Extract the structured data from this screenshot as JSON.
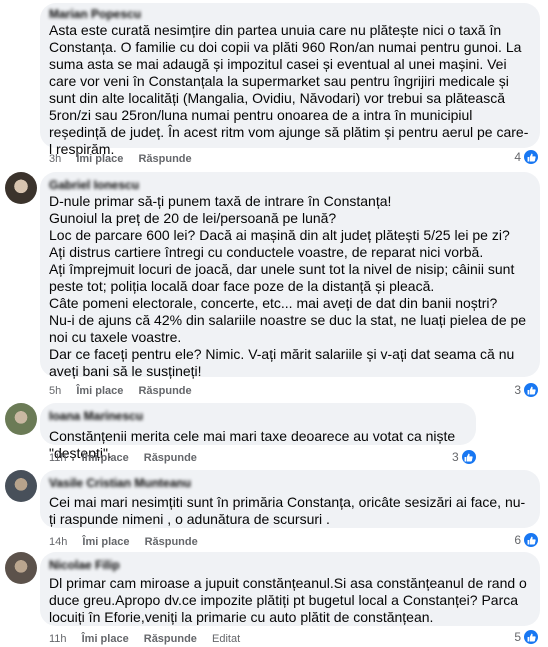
{
  "comments": [
    {
      "author": "Marian Popescu",
      "text": "Asta este curată nesimțire din partea unuia care nu plătește nici o taxă în Constanța. O familie cu doi copii va plăti 960 Ron/an numai pentru gunoi. La suma asta se mai adaugă și impozitul casei și eventual al unei mașini. Vei care vor veni în Constanțala la supermarket sau pentru îngrijiri medicale și sunt din alte localități (Mangalia, Ovidiu, Năvodari) vor trebui sa plătească 5ron/zi sau 25ron/luna numai pentru onoarea de a intra în municipiul reședință de județ. În acest ritm vom ajunge să plătim și pentru aerul pe care-l respirăm.",
      "time": "3h",
      "like_label": "Îmi place",
      "reply_label": "Răspunde",
      "edited_label": "",
      "reactions": "4"
    },
    {
      "author": "Gabriel Ionescu",
      "text": "D-nule primar să-ți punem taxă de intrare în Constanța!\nGunoiul la preț de 20 de lei/persoană pe lună?\nLoc de parcare 600 lei? Dacă ai mașină din alt județ plătești 5/25 lei pe zi?\nAți distrus cartiere întregi cu conductele voastre, de reparat nici vorbă.\nAți împrejmuit locuri de joacă, dar unele sunt tot la nivel de nisip; câinii sunt peste tot; poliția locală doar face poze de la distanță și pleacă.\nCâte pomeni electorale, concerte, etc... mai aveți de dat din banii noștri?\nNu-i de ajuns că 42% din salariile noastre se duc la stat, ne luați pielea de pe noi cu taxele voastre.\nDar ce faceți pentru ele? Nimic. V-ați mărit salariile și v-ați dat seama că nu aveți bani să le susțineți!",
      "time": "5h",
      "like_label": "Îmi place",
      "reply_label": "Răspunde",
      "edited_label": "",
      "reactions": "3"
    },
    {
      "author": "Ioana Marinescu",
      "text": "Constănțenii merita cele mai mari taxe deoarece au votat ca niște \"deștepți\".",
      "time": "11h",
      "like_label": "Îmi place",
      "reply_label": "Răspunde",
      "edited_label": "",
      "reactions": "3"
    },
    {
      "author": "Vasile Cristian Munteanu",
      "text": "Cei mai mari nesimțiti sunt în primăria Constanța, oricâte sesizări ai face, nu-ți raspunde nimeni , o adunătura de scursuri .",
      "time": "14h",
      "like_label": "Îmi place",
      "reply_label": "Răspunde",
      "edited_label": "",
      "reactions": "6"
    },
    {
      "author": "Nicolae Filip",
      "text": "Dl primar cam miroase a jupuit constănțeanul.Si asa constănțeanul de rand o duce greu.Apropo dv.ce impozite plătiți pt bugetul local a Constanței? Parca locuiți în Eforie,veniți la primarie cu auto plătit de constănțean.",
      "time": "11h",
      "like_label": "Îmi place",
      "reply_label": "Răspunde",
      "edited_label": "Editat",
      "reactions": "5"
    }
  ],
  "colors": {
    "like_blue": "#1877f2",
    "bubble": "#f0f2f5",
    "meta": "#65676b"
  }
}
